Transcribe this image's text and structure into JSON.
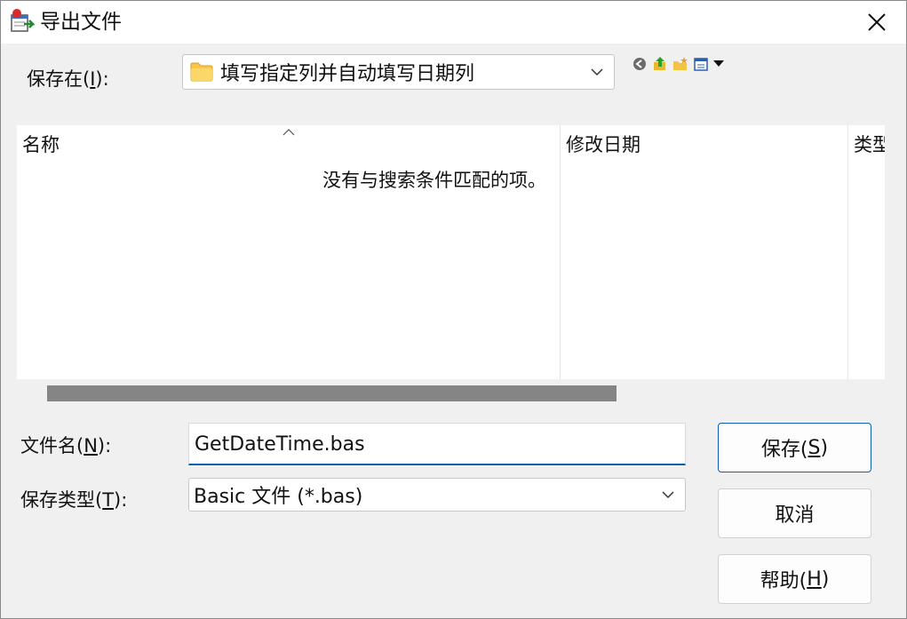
{
  "window": {
    "title": "导出文件",
    "close_symbol": "✕"
  },
  "save_in": {
    "label_prefix": "保存在(",
    "label_key": "I",
    "label_suffix": "):",
    "folder": "填写指定列并自动填写日期列",
    "folder_icon": "folder-icon"
  },
  "toolbar": {
    "icons": [
      "back-icon",
      "up-folder-icon",
      "new-folder-icon",
      "view-menu-icon"
    ]
  },
  "file_list": {
    "columns": [
      "名称",
      "修改日期",
      "类型"
    ],
    "empty_message": "没有与搜索条件匹配的项。"
  },
  "file_name": {
    "label_prefix": "文件名(",
    "label_key": "N",
    "label_suffix": "):",
    "value": "GetDateTime.bas"
  },
  "file_type": {
    "label_prefix": "保存类型(",
    "label_key": "T",
    "label_suffix": "):",
    "value": "Basic 文件 (*.bas)"
  },
  "buttons": {
    "save_prefix": "保存(",
    "save_key": "S",
    "save_suffix": ")",
    "cancel": "取消",
    "help_prefix": "帮助(",
    "help_key": "H",
    "help_suffix": ")"
  },
  "colors": {
    "accent": "#0a5fb4",
    "scrollbar": "#858585",
    "dialog_bg": "#f0f0f0",
    "folder_yellow": "#f7c64a"
  }
}
